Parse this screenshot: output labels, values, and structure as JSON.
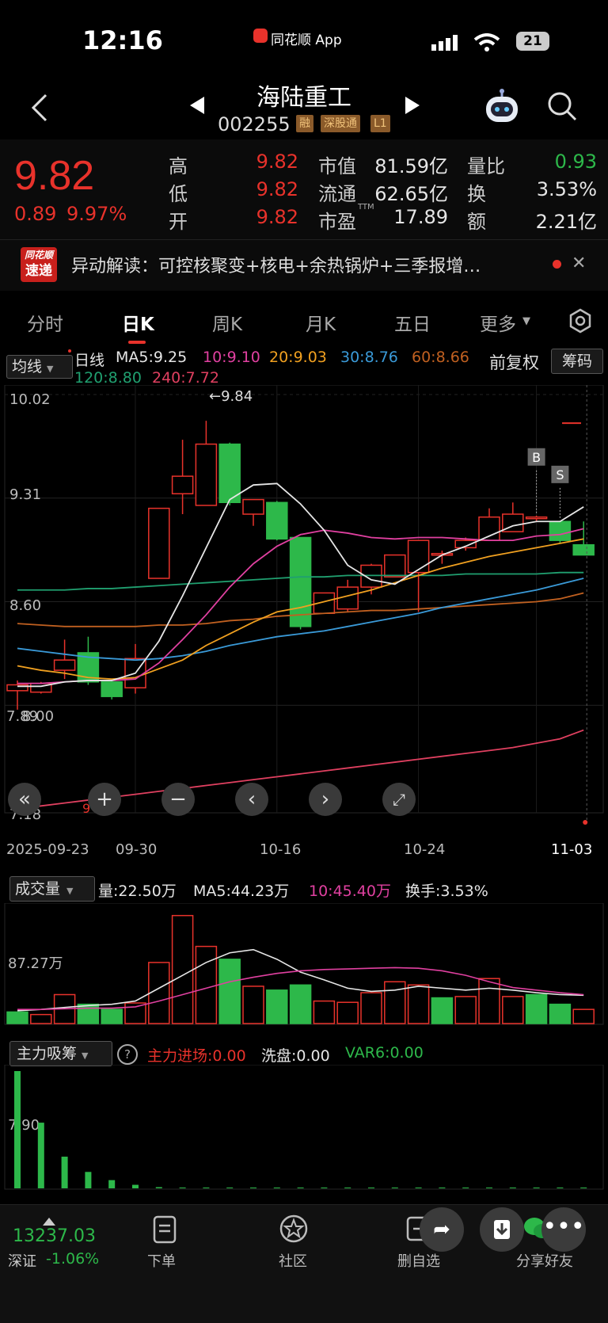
{
  "status_bar": {
    "time": "12:16",
    "app": "同花顺 App",
    "battery": "21"
  },
  "header": {
    "title": "海陆重工",
    "code": "002255",
    "tags": [
      "融",
      "深股通",
      "L1"
    ]
  },
  "quote": {
    "price": "9.82",
    "change": "0.89",
    "change_pct": "9.97%",
    "high_label": "高",
    "high": "9.82",
    "low_label": "低",
    "low": "9.82",
    "open_label": "开",
    "open": "9.82",
    "mcap_label": "市值",
    "mcap": "81.59亿",
    "float_label": "流通",
    "float": "62.65亿",
    "pe_label": "市盈",
    "pe_sup": "TTM",
    "pe": "17.89",
    "vol_ratio_label": "量比",
    "vol_ratio": "0.93",
    "turnover_label": "换",
    "turnover": "3.53%",
    "amount_label": "额",
    "amount": "2.21亿"
  },
  "news": {
    "badge_top": "同花顺",
    "badge_bottom": "速递",
    "text": "异动解读：可控核聚变+核电+余热锅炉+三季报增…"
  },
  "tabs": [
    "分时",
    "日K",
    "周K",
    "月K",
    "五日",
    "更多"
  ],
  "kline_legend": {
    "indicator": "均线",
    "period": "日线",
    "ma5": "MA5:9.25",
    "ma10": "10:9.10",
    "ma20": "20:9.03",
    "ma30": "30:8.76",
    "ma60": "60:8.66",
    "ma120": "120:8.80",
    "ma240": "240:7.72",
    "adjust": "前复权",
    "chips": "筹码"
  },
  "colors": {
    "up": "#e8322b",
    "down": "#2db84a",
    "ma5": "#e6e6e6",
    "ma10": "#e040a0",
    "ma20": "#f0a020",
    "ma30": "#3a9ad8",
    "ma60": "#c06020",
    "ma120": "#20a070",
    "ma240": "#e04060"
  },
  "price_axis": {
    "top": "10.02",
    "mid1": "9.31",
    "mid2": "8.60",
    "low": "8.00",
    "low_overlap": "7.89",
    "bottom": "7.18",
    "max_label": "←9.84"
  },
  "date_axis": [
    "2025-09-23",
    "09-30",
    "10-16",
    "10-24",
    "11-03"
  ],
  "chart_data": {
    "type": "candlestick",
    "candles": [
      {
        "o": 7.99,
        "c": 8.03,
        "h": 8.06,
        "l": 7.86
      },
      {
        "o": 7.98,
        "c": 8.04,
        "h": 8.05,
        "l": 7.97
      },
      {
        "o": 8.13,
        "c": 8.2,
        "h": 8.34,
        "l": 8.07
      },
      {
        "o": 8.25,
        "c": 8.05,
        "h": 8.36,
        "l": 8.03
      },
      {
        "o": 8.05,
        "c": 7.95,
        "h": 8.07,
        "l": 7.93
      },
      {
        "o": 8.01,
        "c": 8.21,
        "h": 8.31,
        "l": 7.97
      },
      {
        "o": 8.76,
        "c": 9.24,
        "h": 9.24,
        "l": 8.76
      },
      {
        "o": 9.34,
        "c": 9.46,
        "h": 9.71,
        "l": 9.2
      },
      {
        "o": 9.26,
        "c": 9.68,
        "h": 9.84,
        "l": 9.26
      },
      {
        "o": 9.68,
        "c": 9.28,
        "h": 9.69,
        "l": 9.26
      },
      {
        "o": 9.2,
        "c": 9.3,
        "h": 9.3,
        "l": 9.12
      },
      {
        "o": 9.28,
        "c": 9.03,
        "h": 9.29,
        "l": 9.02
      },
      {
        "o": 9.04,
        "c": 8.43,
        "h": 9.04,
        "l": 8.41
      },
      {
        "o": 8.52,
        "c": 8.66,
        "h": 8.66,
        "l": 8.52
      },
      {
        "o": 8.55,
        "c": 8.7,
        "h": 8.75,
        "l": 8.53
      },
      {
        "o": 8.7,
        "c": 8.85,
        "h": 8.86,
        "l": 8.65
      },
      {
        "o": 8.77,
        "c": 8.92,
        "h": 8.92,
        "l": 8.77
      },
      {
        "o": 8.8,
        "c": 9.02,
        "h": 9.02,
        "l": 8.53
      },
      {
        "o": 8.93,
        "c": 8.93,
        "h": 8.95,
        "l": 8.86
      },
      {
        "o": 8.97,
        "c": 9.02,
        "h": 9.04,
        "l": 8.95
      },
      {
        "o": 9.02,
        "c": 9.18,
        "h": 9.24,
        "l": 9.02
      },
      {
        "o": 9.08,
        "c": 9.2,
        "h": 9.28,
        "l": 9.08
      },
      {
        "o": 9.17,
        "c": 9.18,
        "h": 9.19,
        "l": 9.15
      },
      {
        "o": 9.15,
        "c": 9.02,
        "h": 9.15,
        "l": 9.0
      },
      {
        "o": 8.99,
        "c": 8.92,
        "h": 9.15,
        "l": 8.92
      }
    ],
    "ma5": [
      8.02,
      8.02,
      8.05,
      8.06,
      8.06,
      8.11,
      8.33,
      8.64,
      8.97,
      9.3,
      9.4,
      9.41,
      9.27,
      9.09,
      8.85,
      8.75,
      8.72,
      8.82,
      8.92,
      8.98,
      9.05,
      9.12,
      9.15,
      9.15,
      9.25
    ],
    "ma10": [
      8.04,
      8.04,
      8.05,
      8.06,
      8.06,
      8.07,
      8.18,
      8.34,
      8.51,
      8.7,
      8.86,
      8.98,
      9.06,
      9.09,
      9.07,
      9.04,
      9.03,
      9.04,
      9.04,
      9.03,
      9.02,
      9.02,
      9.05,
      9.06,
      9.1
    ],
    "ma20": [
      8.16,
      8.13,
      8.11,
      8.08,
      8.07,
      8.08,
      8.14,
      8.2,
      8.3,
      8.38,
      8.46,
      8.53,
      8.56,
      8.6,
      8.64,
      8.68,
      8.73,
      8.78,
      8.83,
      8.87,
      8.91,
      8.94,
      8.97,
      9.0,
      9.03
    ],
    "ma30": [
      8.28,
      8.26,
      8.24,
      8.22,
      8.21,
      8.2,
      8.21,
      8.23,
      8.26,
      8.3,
      8.33,
      8.36,
      8.38,
      8.4,
      8.43,
      8.46,
      8.49,
      8.52,
      8.56,
      8.59,
      8.62,
      8.65,
      8.68,
      8.72,
      8.76
    ],
    "ma60": [
      8.45,
      8.44,
      8.43,
      8.43,
      8.43,
      8.43,
      8.44,
      8.44,
      8.45,
      8.47,
      8.48,
      8.5,
      8.51,
      8.52,
      8.53,
      8.54,
      8.54,
      8.55,
      8.56,
      8.57,
      8.58,
      8.59,
      8.6,
      8.62,
      8.66
    ],
    "ma120": [
      8.68,
      8.68,
      8.68,
      8.69,
      8.69,
      8.7,
      8.71,
      8.72,
      8.73,
      8.74,
      8.75,
      8.76,
      8.77,
      8.77,
      8.78,
      8.78,
      8.78,
      8.78,
      8.78,
      8.79,
      8.79,
      8.79,
      8.79,
      8.8,
      8.8
    ],
    "ma240": [
      7.18,
      7.2,
      7.22,
      7.24,
      7.26,
      7.28,
      7.3,
      7.32,
      7.34,
      7.36,
      7.38,
      7.4,
      7.42,
      7.44,
      7.46,
      7.48,
      7.5,
      7.52,
      7.54,
      7.56,
      7.58,
      7.6,
      7.63,
      7.66,
      7.72
    ],
    "volume_legend": {
      "indicator": "成交量",
      "vol": "量:22.50万",
      "ma5": "MA5:44.23万",
      "ma10": "10:45.40万",
      "turnover": "换手:3.53%",
      "axis": "87.27万"
    },
    "volume": [
      18,
      14,
      45,
      30,
      22,
      32,
      95,
      168,
      120,
      100,
      58,
      52,
      60,
      35,
      33,
      48,
      65,
      60,
      40,
      42,
      70,
      42,
      45,
      30,
      22
    ],
    "volume_up": [
      false,
      true,
      true,
      false,
      false,
      true,
      true,
      true,
      true,
      false,
      true,
      false,
      false,
      true,
      true,
      true,
      true,
      true,
      false,
      true,
      true,
      true,
      false,
      false,
      true
    ],
    "volume_ma5": [
      20,
      22,
      25,
      28,
      30,
      35,
      55,
      75,
      95,
      110,
      115,
      100,
      80,
      68,
      55,
      50,
      52,
      58,
      55,
      52,
      55,
      52,
      48,
      45,
      44
    ],
    "volume_ma10": [
      22,
      22,
      23,
      24,
      24,
      26,
      35,
      45,
      55,
      65,
      72,
      78,
      82,
      84,
      85,
      86,
      87,
      86,
      82,
      75,
      65,
      56,
      52,
      48,
      45
    ],
    "sub_legend": {
      "indicator": "主力吸筹",
      "main_in": "主力进场:0.00",
      "wash": "洗盘:0.00",
      "var6": "VAR6:0.00",
      "axis": "7.90"
    },
    "sub_bars": [
      100,
      56,
      27,
      14,
      7,
      3,
      1,
      0.5,
      0.5,
      0.3,
      0.3,
      0.2,
      0.2,
      0.2,
      0.2,
      0.2,
      0.2,
      0.2,
      0.2,
      0.2,
      0.2,
      0.2,
      0.2,
      0.2,
      0.2
    ],
    "ylim": [
      7.18,
      10.02
    ]
  },
  "bottom": {
    "index_value": "13237.03",
    "index_name": "深证",
    "index_chg": "-1.06%",
    "order": "下单",
    "community": "社区",
    "remove_fav": "删自选",
    "share": "分享好友"
  },
  "signals": {
    "buy": "B",
    "sell": "S"
  }
}
